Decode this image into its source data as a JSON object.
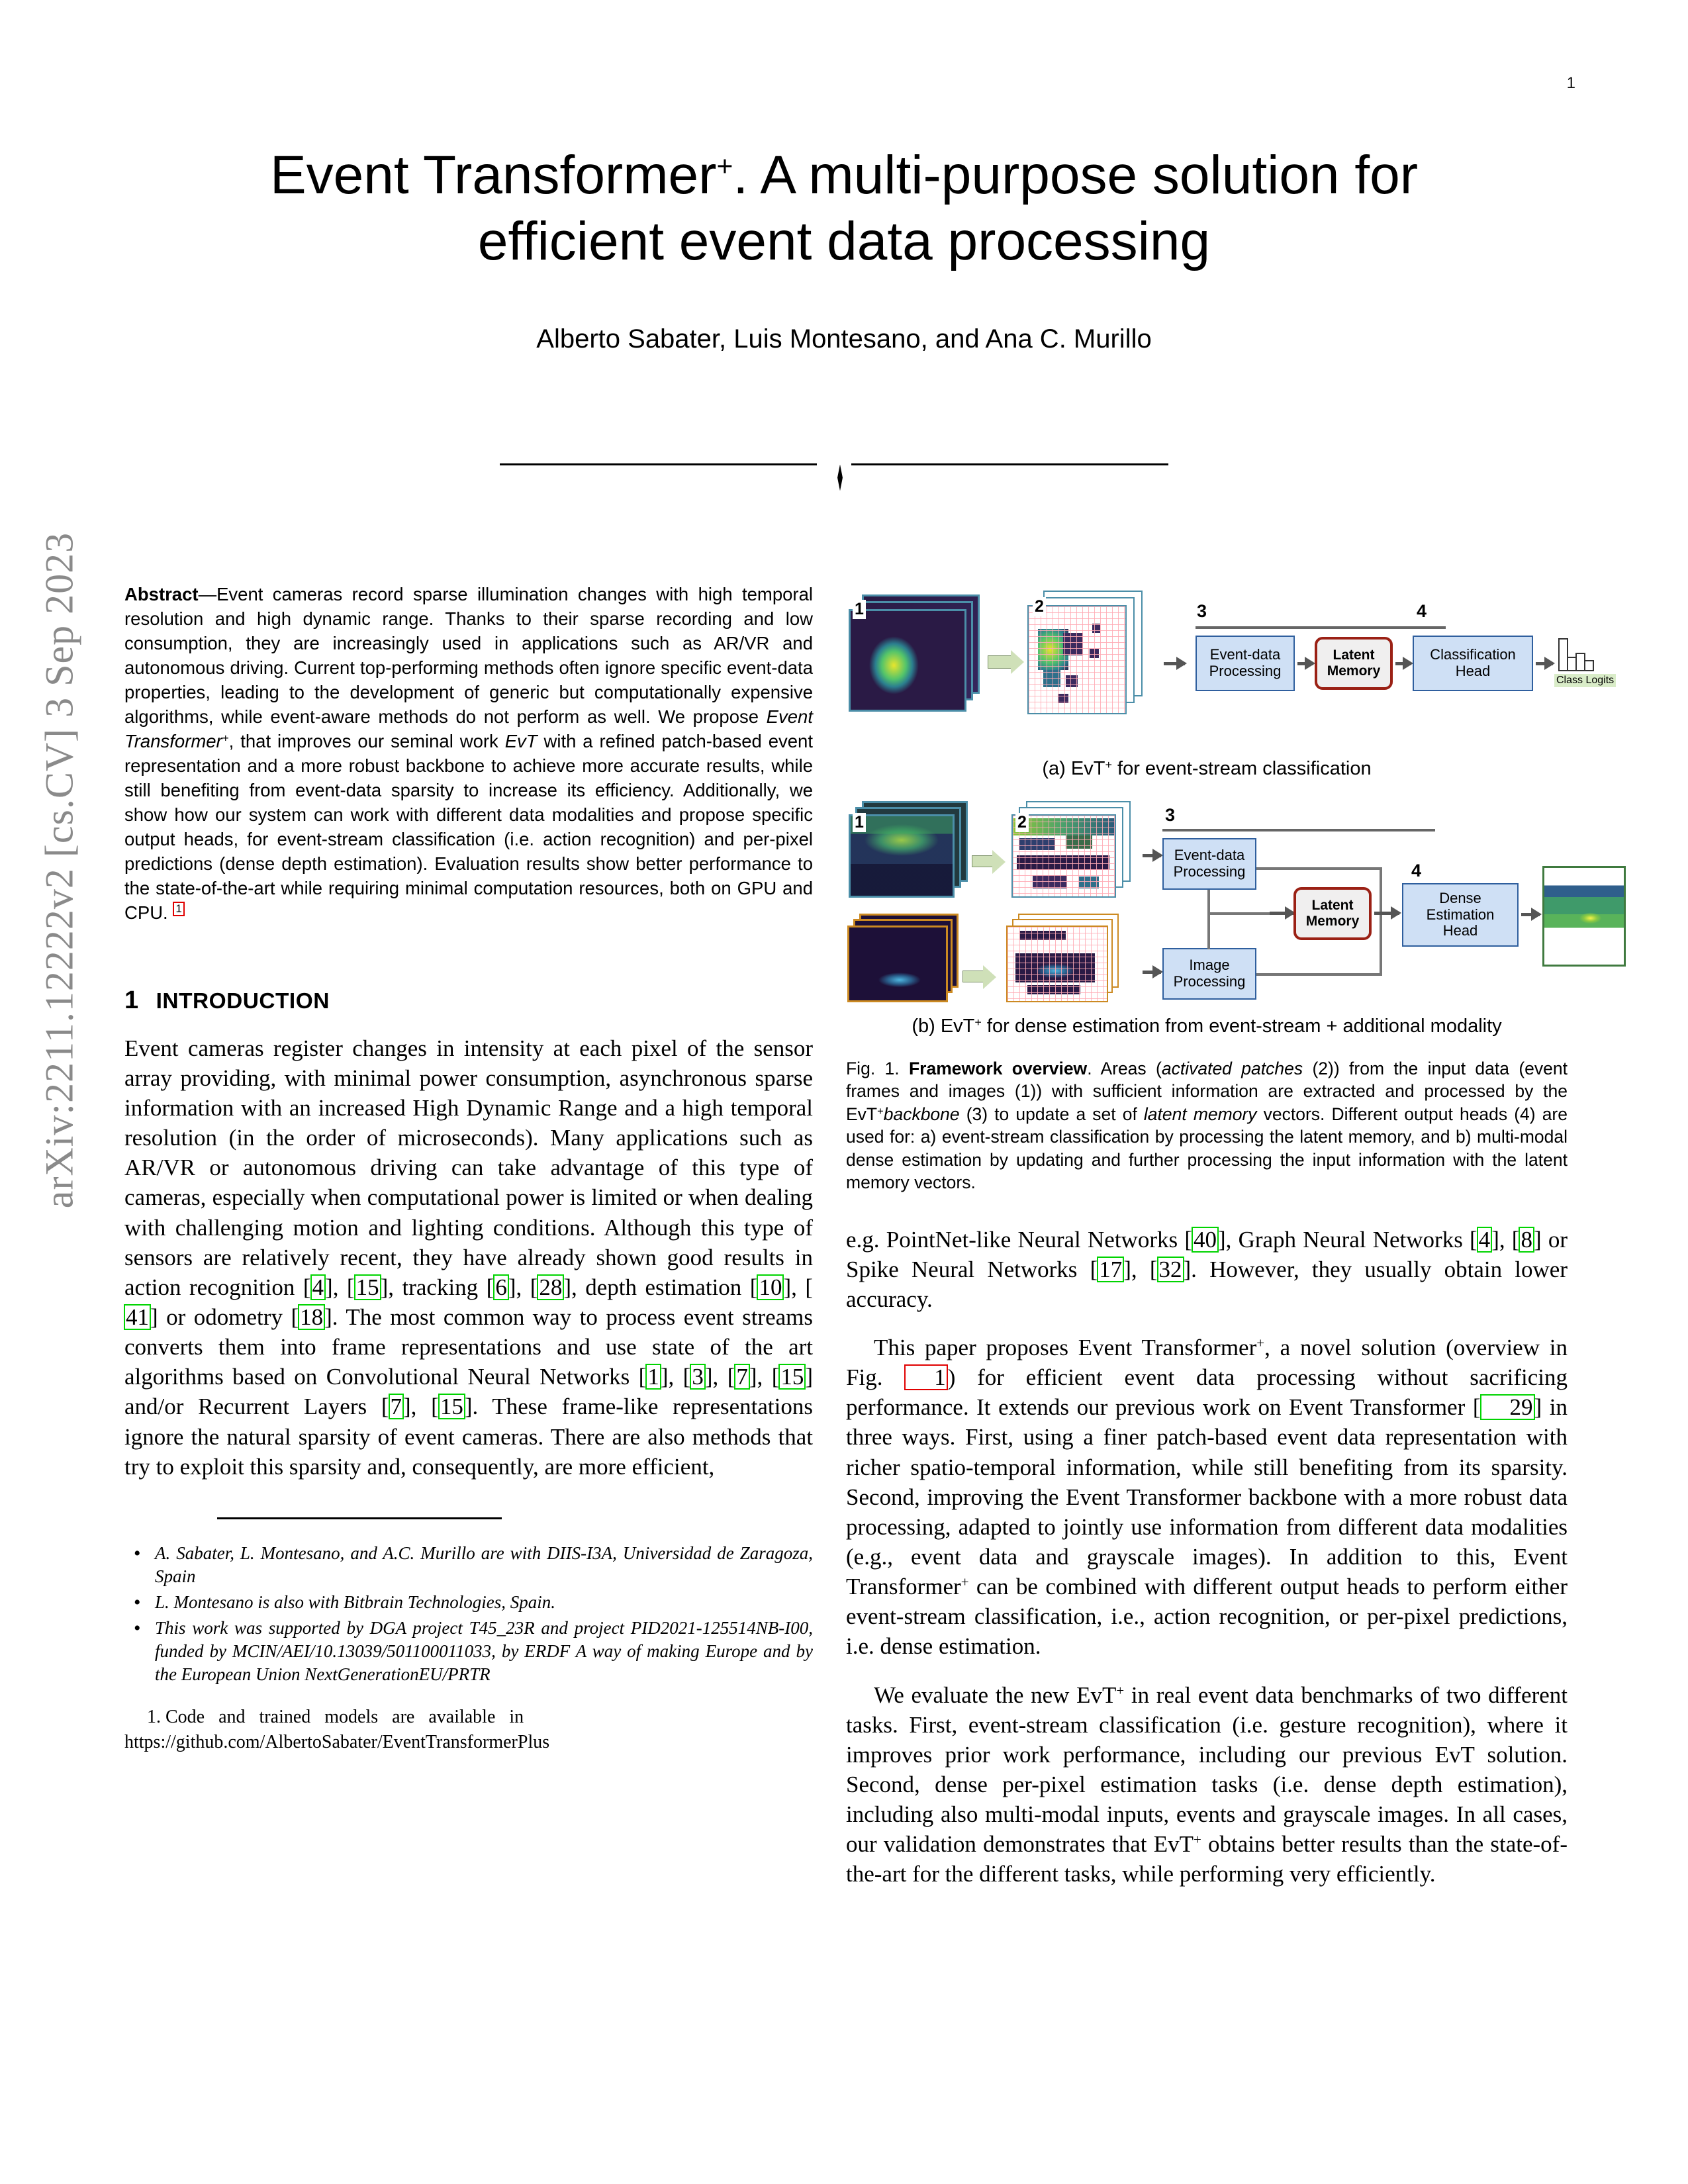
{
  "page": {
    "number": "1",
    "arxiv_stamp": "arXiv:2211.12222v2  [cs.CV]  3 Sep 2023"
  },
  "title": {
    "line1_pre": "Event Transformer",
    "line1_sup": "+",
    "line1_post": ". A multi-purpose solution for",
    "line2": "efficient event data processing"
  },
  "authors": "Alberto Sabater, Luis Montesano, and Ana C. Murillo",
  "abstract": {
    "label": "Abstract",
    "dash": "—",
    "p1": "Event cameras record sparse illumination changes with high temporal resolution and high dynamic range. Thanks to their sparse recording and low consumption, they are increasingly used in applications such as AR/VR and autonomous driving. Current top-performing methods often ignore specific event-data properties, leading to the development of generic but computationally expensive algorithms, while event-aware methods do not perform as well. We propose ",
    "em1": "Event Transformer",
    "em1_sup": "+",
    "p2": ", that improves our seminal work ",
    "em2": "EvT",
    "p3": " with a refined patch-based event representation and a more robust backbone to achieve more accurate results, while still benefiting from event-data sparsity to increase its efficiency. Additionally, we show how our system can work with different data modalities and propose specific output heads, for event-stream classification (i.e. action recognition) and per-pixel predictions (dense depth estimation). Evaluation results show better performance to the state-of-the-art while requiring minimal computation resources, both on GPU and CPU.",
    "footnote_marker": "1"
  },
  "section1": {
    "number": "1",
    "title": "Introduction",
    "p1_a": "Event cameras register changes in intensity at each pixel of the sensor array providing, with minimal power consumption, asynchronous sparse information with an increased High Dynamic Range and a high temporal resolution (in the order of microseconds). Many applications such as AR/VR or autonomous driving can take advantage of this type of cameras, especially when computational power is limited or when dealing with challenging motion and lighting conditions. Although this type of sensors are relatively recent, they have already shown good results in action recognition ",
    "cites_action": [
      "4",
      "15"
    ],
    "p1_b": ", tracking ",
    "cites_tracking": [
      "6",
      "28"
    ],
    "p1_c": ", depth estimation ",
    "cites_depth": [
      "10",
      "41"
    ],
    "p1_d": " or odometry ",
    "cites_odometry": [
      "18"
    ],
    "p1_e": ". The most common way to process event streams converts them into frame representations and use state of the art algorithms based on Convolutional Neural Networks ",
    "cites_cnn": [
      "1",
      "3",
      "7",
      "15"
    ],
    "p1_f": " and/or Recurrent Layers ",
    "cites_rnn": [
      "7",
      "15"
    ],
    "p1_g": ". These frame-like representations ignore the natural sparsity of event cameras. There are also methods that try to exploit this sparsity and, consequently, are more efficient,",
    "p2_a": "e.g. PointNet-like Neural Networks ",
    "cites_pointnet": [
      "40"
    ],
    "p2_b": ", Graph Neural Networks ",
    "cites_gnn": [
      "4",
      "8"
    ],
    "p2_c": " or Spike Neural Networks ",
    "cites_snn": [
      "17",
      "32"
    ],
    "p2_d": ". However, they usually obtain lower accuracy.",
    "p3_a": "This paper proposes Event Transformer",
    "p3_sup": "+",
    "p3_b": ", a novel solution (overview in Fig. ",
    "figref1": "1",
    "p3_c": ") for efficient event data processing without sacrificing performance. It extends our previous work on Event Transformer ",
    "cites_evt": [
      "29"
    ],
    "p3_d": " in three ways. First, using a finer patch-based event data representation with richer spatio-temporal information, while still benefiting from its sparsity. Second, improving the Event Transformer backbone with a more robust data processing, adapted to jointly use information from different data modalities (e.g., event data and grayscale images). In addition to this, Event Transformer",
    "p3_sup2": "+",
    "p3_e": " can be combined with different output heads to perform either event-stream classification, i.e., action recognition, or per-pixel predictions, i.e. dense estimation.",
    "p4_a": "We evaluate the new EvT",
    "p4_sup": "+",
    "p4_b": " in real event data benchmarks of two different tasks. First, event-stream classification (i.e. gesture recognition), where it improves prior work performance, including our previous EvT solution. Second, dense per-pixel estimation tasks (i.e. dense depth estimation), including also multi-modal inputs, events and grayscale images. In all cases, our validation demonstrates that EvT",
    "p4_sup2": "+",
    "p4_c": " obtains better results than the state-of-the-art for the different tasks, while performing very efficiently."
  },
  "footnotes": {
    "items": [
      "A. Sabater, L. Montesano, and A.C. Murillo are with DIIS-I3A, Universidad de Zaragoza, Spain",
      "L. Montesano is also with Bitbrain Technologies, Spain.",
      "This work was supported by DGA project T45_23R and project PID2021-125514NB-I00, funded by MCIN/AEI/10.13039/501100011033, by ERDF A way of making Europe and by the European Union NextGenerationEU/PRTR"
    ],
    "code_number": "1.",
    "code_text": "Code and trained models are available in",
    "code_url": "https://github.com/AlbertoSabater/EventTransformerPlus"
  },
  "figure": {
    "subfig_a": {
      "caption_pre": "(a) EvT",
      "caption_sup": "+",
      "caption_post": " for event-stream classification",
      "labels": {
        "one": "1",
        "two": "2",
        "three": "3",
        "four": "4"
      },
      "boxes": {
        "event_processing": "Event-data\nProcessing",
        "latent_memory": "Latent\nMemory",
        "classification_head": "Classification\nHead"
      },
      "class_logits_label": "Class Logits"
    },
    "subfig_b": {
      "caption_pre": "(b) EvT",
      "caption_sup": "+",
      "caption_post": " for dense estimation from event-stream + additional modality",
      "labels": {
        "one": "1",
        "two": "2",
        "three": "3",
        "four": "4"
      },
      "boxes": {
        "event_processing": "Event-data\nProcessing",
        "image_processing": "Image\nProcessing",
        "latent_memory": "Latent\nMemory",
        "dense_head": "Dense\nEstimation\nHead"
      }
    },
    "caption": {
      "prefix": "Fig. 1.",
      "bold": "Framework overview",
      "t1": ". Areas (",
      "i1": "activated patches",
      "t2": " (2)) from the input data (event frames and images (1)) with sufficient information are extracted and processed by the EvT",
      "sup": "+",
      "i2": "backbone",
      "t3": " (3) to update a set of ",
      "i3": "latent memory",
      "t4": " vectors. Different output heads (4) are used for: a) event-stream classification by processing the latent memory, and b) multi-modal dense estimation by updating and further processing the input information with the latent memory vectors."
    }
  },
  "colors": {
    "citation_box": "#00d400",
    "figure_ref_box": "#e00000",
    "process_box_fill": "#cfe0f5",
    "process_box_border": "#2f5f9e",
    "memory_box_border": "#9b2115",
    "arxiv_stamp": "#8a8a8a"
  }
}
